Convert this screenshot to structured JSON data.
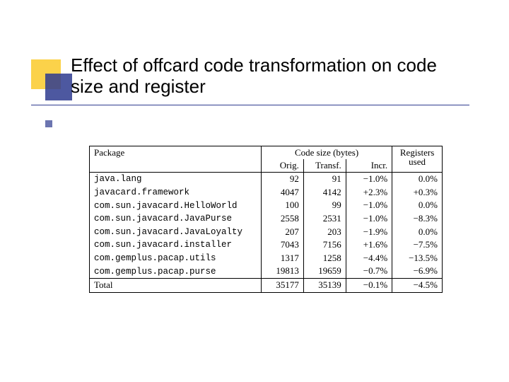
{
  "title": "Effect of offcard code transformation on code size and register",
  "headers": {
    "package": "Package",
    "codesize": "Code size (bytes)",
    "orig": "Orig.",
    "transf": "Transf.",
    "incr": "Incr.",
    "registers": "Registers used"
  },
  "rows": [
    {
      "pkg": "java.lang",
      "orig": "92",
      "transf": "91",
      "incr": "−1.0%",
      "reg": "0.0%"
    },
    {
      "pkg": "javacard.framework",
      "orig": "4047",
      "transf": "4142",
      "incr": "+2.3%",
      "reg": "+0.3%"
    },
    {
      "pkg": "com.sun.javacard.HelloWorld",
      "orig": "100",
      "transf": "99",
      "incr": "−1.0%",
      "reg": "0.0%"
    },
    {
      "pkg": "com.sun.javacard.JavaPurse",
      "orig": "2558",
      "transf": "2531",
      "incr": "−1.0%",
      "reg": "−8.3%"
    },
    {
      "pkg": "com.sun.javacard.JavaLoyalty",
      "orig": "207",
      "transf": "203",
      "incr": "−1.9%",
      "reg": "0.0%"
    },
    {
      "pkg": "com.sun.javacard.installer",
      "orig": "7043",
      "transf": "7156",
      "incr": "+1.6%",
      "reg": "−7.5%"
    },
    {
      "pkg": "com.gemplus.pacap.utils",
      "orig": "1317",
      "transf": "1258",
      "incr": "−4.4%",
      "reg": "−13.5%"
    },
    {
      "pkg": "com.gemplus.pacap.purse",
      "orig": "19813",
      "transf": "19659",
      "incr": "−0.7%",
      "reg": "−6.9%"
    },
    {
      "pkg": "Total",
      "orig": "35177",
      "transf": "35139",
      "incr": "−0.1%",
      "reg": "−4.5%"
    }
  ],
  "chart_data": {
    "type": "table",
    "title": "Effect of offcard code transformation on code size and register",
    "columns": [
      "Package",
      "Orig.",
      "Transf.",
      "Incr.",
      "Registers used"
    ],
    "rows": [
      [
        "java.lang",
        92,
        91,
        -1.0,
        0.0
      ],
      [
        "javacard.framework",
        4047,
        4142,
        2.3,
        0.3
      ],
      [
        "com.sun.javacard.HelloWorld",
        100,
        99,
        -1.0,
        0.0
      ],
      [
        "com.sun.javacard.JavaPurse",
        2558,
        2531,
        -1.0,
        -8.3
      ],
      [
        "com.sun.javacard.JavaLoyalty",
        207,
        203,
        -1.9,
        0.0
      ],
      [
        "com.sun.javacard.installer",
        7043,
        7156,
        1.6,
        -7.5
      ],
      [
        "com.gemplus.pacap.utils",
        1317,
        1258,
        -4.4,
        -13.5
      ],
      [
        "com.gemplus.pacap.purse",
        19813,
        19659,
        -0.7,
        -6.9
      ],
      [
        "Total",
        35177,
        35139,
        -0.1,
        -4.5
      ]
    ],
    "column_units": [
      "",
      "bytes",
      "bytes",
      "%",
      "%"
    ]
  }
}
